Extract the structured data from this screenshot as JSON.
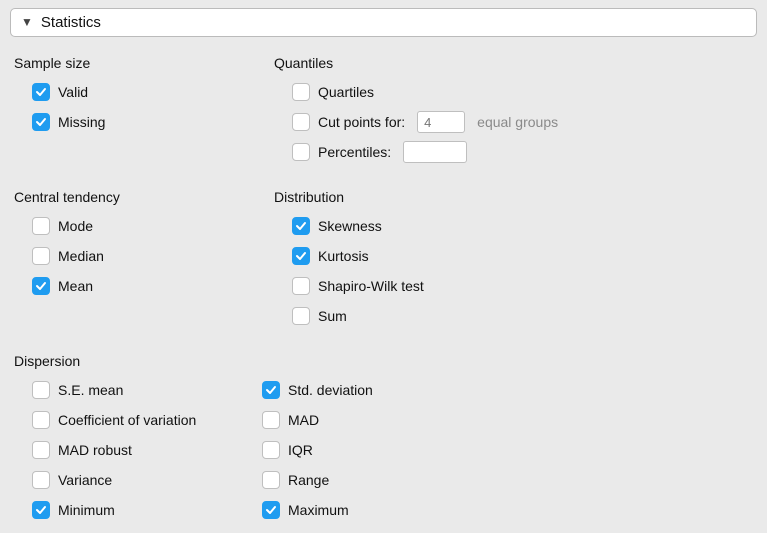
{
  "panel": {
    "title": "Statistics"
  },
  "sample_size": {
    "heading": "Sample size",
    "valid": {
      "label": "Valid",
      "checked": true
    },
    "missing": {
      "label": "Missing",
      "checked": true
    }
  },
  "quantiles": {
    "heading": "Quantiles",
    "quartiles": {
      "label": "Quartiles",
      "checked": false
    },
    "cutpoints": {
      "label": "Cut points for:",
      "checked": false,
      "value": "4",
      "suffix": "equal groups"
    },
    "percentiles": {
      "label": "Percentiles:",
      "checked": false,
      "value": ""
    }
  },
  "central": {
    "heading": "Central tendency",
    "mode": {
      "label": "Mode",
      "checked": false
    },
    "median": {
      "label": "Median",
      "checked": false
    },
    "mean": {
      "label": "Mean",
      "checked": true
    }
  },
  "distribution": {
    "heading": "Distribution",
    "skewness": {
      "label": "Skewness",
      "checked": true
    },
    "kurtosis": {
      "label": "Kurtosis",
      "checked": true
    },
    "shapiro": {
      "label": "Shapiro-Wilk test",
      "checked": false
    },
    "sum": {
      "label": "Sum",
      "checked": false
    }
  },
  "dispersion": {
    "heading": "Dispersion",
    "se_mean": {
      "label": "S.E. mean",
      "checked": false
    },
    "coef_var": {
      "label": "Coefficient of variation",
      "checked": false
    },
    "mad_robust": {
      "label": "MAD robust",
      "checked": false
    },
    "variance": {
      "label": "Variance",
      "checked": false
    },
    "minimum": {
      "label": "Minimum",
      "checked": true
    },
    "std_dev": {
      "label": "Std. deviation",
      "checked": true
    },
    "mad": {
      "label": "MAD",
      "checked": false
    },
    "iqr": {
      "label": "IQR",
      "checked": false
    },
    "range": {
      "label": "Range",
      "checked": false
    },
    "maximum": {
      "label": "Maximum",
      "checked": true
    }
  }
}
